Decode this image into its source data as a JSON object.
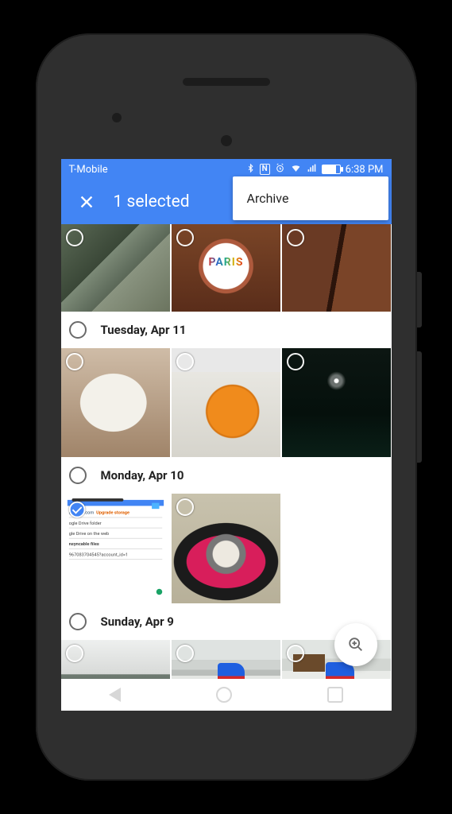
{
  "status": {
    "carrier": "T-Mobile",
    "time": "6:38 PM",
    "icons": {
      "bluetooth": "BT",
      "nfc": "N",
      "alarm": "⏰",
      "wifi": "wifi",
      "signal": "sig"
    }
  },
  "appbar": {
    "title": "1 selected"
  },
  "menu": {
    "archive": "Archive"
  },
  "sections": [
    {
      "label": "Tuesday, Apr 11"
    },
    {
      "label": "Monday, Apr 10"
    },
    {
      "label": "Sunday, Apr 9"
    }
  ],
  "screenshot_thumb": {
    "line1a": "@gmail.com",
    "line1b": "Upgrade storage",
    "line2": "ogle Drive folder",
    "line3": "gle Drive on the web",
    "line4": "nsyncable files",
    "line5": "967083704545?account_id=1"
  }
}
